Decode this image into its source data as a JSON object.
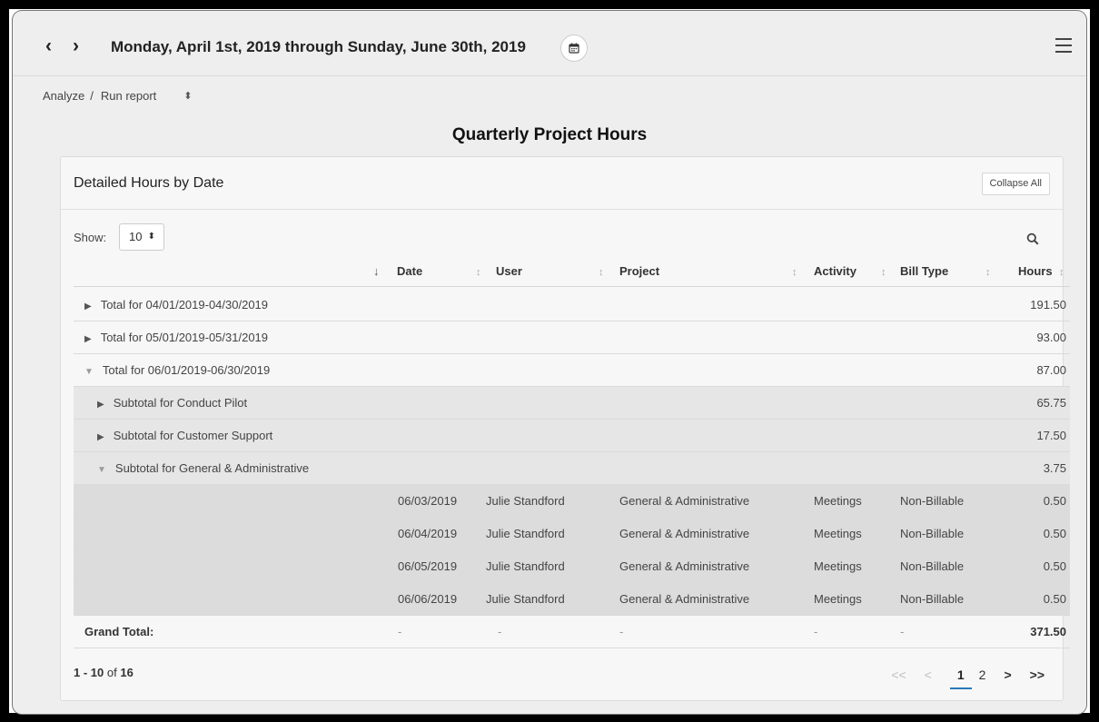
{
  "header": {
    "date_range": "Monday, April 1st, 2019 through Sunday, June 30th, 2019",
    "prev_icon": "chevron-left-icon",
    "next_icon": "chevron-right-icon",
    "calendar_icon": "calendar-icon",
    "menu_icon": "hamburger-menu-icon"
  },
  "breadcrumb": {
    "root": "Analyze",
    "separator": "/",
    "current": "Run report"
  },
  "report_title": "Quarterly Project Hours",
  "panel": {
    "title": "Detailed Hours by Date",
    "collapse_label": "Collapse All",
    "show_label": "Show:",
    "show_value": "10"
  },
  "columns": [
    "Date",
    "User",
    "Project",
    "Activity",
    "Bill Type",
    "Hours"
  ],
  "totals": [
    {
      "label": "Total for 04/01/2019-04/30/2019",
      "hours": "191.50",
      "expanded": false
    },
    {
      "label": "Total for 05/01/2019-05/31/2019",
      "hours": "93.00",
      "expanded": false
    },
    {
      "label": "Total for 06/01/2019-06/30/2019",
      "hours": "87.00",
      "expanded": true
    }
  ],
  "subtotals": [
    {
      "label": "Subtotal for Conduct Pilot",
      "hours": "65.75",
      "expanded": false
    },
    {
      "label": "Subtotal for Customer Support",
      "hours": "17.50",
      "expanded": false
    },
    {
      "label": "Subtotal for General & Administrative",
      "hours": "3.75",
      "expanded": true
    }
  ],
  "details": [
    {
      "date": "06/03/2019",
      "user": "Julie Standford",
      "project": "General & Administrative",
      "activity": "Meetings",
      "bill_type": "Non-Billable",
      "hours": "0.50"
    },
    {
      "date": "06/04/2019",
      "user": "Julie Standford",
      "project": "General & Administrative",
      "activity": "Meetings",
      "bill_type": "Non-Billable",
      "hours": "0.50"
    },
    {
      "date": "06/05/2019",
      "user": "Julie Standford",
      "project": "General & Administrative",
      "activity": "Meetings",
      "bill_type": "Non-Billable",
      "hours": "0.50"
    },
    {
      "date": "06/06/2019",
      "user": "Julie Standford",
      "project": "General & Administrative",
      "activity": "Meetings",
      "bill_type": "Non-Billable",
      "hours": "0.50"
    }
  ],
  "grand_total": {
    "label": "Grand Total:",
    "dash": "-",
    "hours": "371.50"
  },
  "footer": {
    "range": "1 - 10",
    "of_word": "of",
    "total": "16"
  },
  "pager": {
    "first": "<<",
    "prev": "<",
    "pages": [
      "1",
      "2"
    ],
    "next": ">",
    "last": ">>"
  },
  "colors": {
    "accent": "#2a7ab8",
    "background": "#eeeeee",
    "panel": "#f7f7f7"
  }
}
